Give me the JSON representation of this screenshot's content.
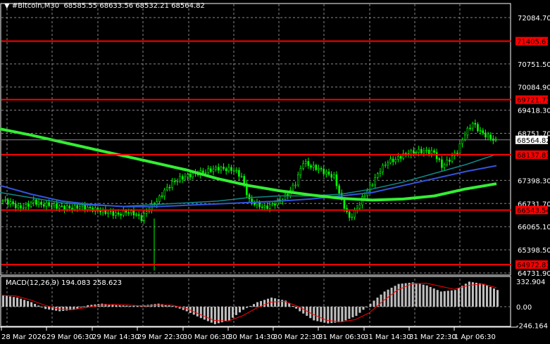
{
  "header": {
    "symbol": "#Bitcoin,M30",
    "open": "68585.55",
    "high": "68633.56",
    "low": "68532.21",
    "close": "68564.82"
  },
  "macd": {
    "label": "MACD(12,26,9)",
    "main": "194.083",
    "signal": "258.623",
    "axis_ticks": [
      "332.904",
      "0.00",
      "-246.164"
    ]
  },
  "price_axis": {
    "ticks": [
      "72084.70",
      "70751.50",
      "70084.90",
      "69418.30",
      "68751.70",
      "67398.30",
      "66731.70",
      "66065.10",
      "65398.50",
      "64731.90"
    ],
    "current_price": "68564.82"
  },
  "levels": [
    {
      "label": "71405.67",
      "value": 71405.67
    },
    {
      "label": "69721.71",
      "value": 69721.71
    },
    {
      "label": "68137.83",
      "value": 68137.83
    },
    {
      "label": "66543.54",
      "value": 66543.54
    },
    {
      "label": "64972.81",
      "value": 64972.81
    }
  ],
  "time_axis": [
    "28 Mar 2026",
    "29 Mar 06:30",
    "29 Mar 14:30",
    "29 Mar 22:30",
    "30 Mar 06:30",
    "30 Mar 14:30",
    "30 Mar 22:30",
    "31 Mar 06:30",
    "31 Mar 14:30",
    "31 Mar 22:30",
    "1 Apr 06:30"
  ],
  "colors": {
    "candles": "#00ff00",
    "levels": "#ff0000",
    "ma_slow": "#33ee33",
    "ma_mid": "#3355dd",
    "ma_fast": "#118888",
    "macd_hist": "#c0c0c0",
    "macd_signal": "#ff0000"
  },
  "chart_data": {
    "type": "candlestick",
    "closes": [
      66818,
      66750,
      66615,
      66650,
      66800,
      66700,
      66700,
      66650,
      66620,
      66600,
      66650,
      66600,
      66550,
      66500,
      66460,
      66413,
      66500,
      66450,
      66300,
      66600,
      66800,
      67100,
      67324,
      67450,
      67528,
      67600,
      67628,
      67700,
      67750,
      67720,
      67700,
      67500,
      66818,
      66700,
      66615,
      66700,
      66818,
      67000,
      67324,
      67932,
      67800,
      67732,
      67600,
      67500,
      66818,
      66300,
      66600,
      67000,
      67324,
      67700,
      67932,
      68000,
      68136,
      68200,
      68236,
      68236,
      68200,
      67800,
      68000,
      68236,
      68742,
      69046,
      68800,
      68650,
      68540
    ],
    "ma_slow": [
      68880,
      68700,
      68500,
      68300,
      68100,
      67900,
      67700,
      67450,
      67250,
      67100,
      66980,
      66880,
      66830,
      66860,
      66950,
      67150,
      67300
    ],
    "ma_mid": [
      67250,
      67000,
      66800,
      66700,
      66640,
      66640,
      66680,
      66720,
      66760,
      66800,
      66860,
      66950,
      67050,
      67250,
      67450,
      67650,
      67820
    ],
    "ma_fast": [
      67050,
      66900,
      66750,
      66680,
      66650,
      66700,
      66750,
      66800,
      66900,
      66950,
      66950,
      67000,
      67150,
      67350,
      67600,
      67850,
      68150
    ],
    "macd_hist": [
      150,
      120,
      60,
      -30,
      -60,
      -40,
      20,
      40,
      20,
      10,
      20,
      40,
      10,
      -60,
      -150,
      -230,
      -180,
      -40,
      60,
      120,
      80,
      -60,
      -180,
      -220,
      -200,
      -120,
      40,
      200,
      300,
      320,
      280,
      200,
      220,
      330,
      300,
      220
    ],
    "macd_signal": [
      150,
      140,
      90,
      20,
      -30,
      -40,
      -10,
      20,
      30,
      20,
      10,
      20,
      20,
      -20,
      -100,
      -180,
      -190,
      -120,
      -20,
      60,
      70,
      0,
      -100,
      -180,
      -200,
      -170,
      -80,
      80,
      220,
      300,
      310,
      270,
      230,
      280,
      300,
      250
    ]
  }
}
